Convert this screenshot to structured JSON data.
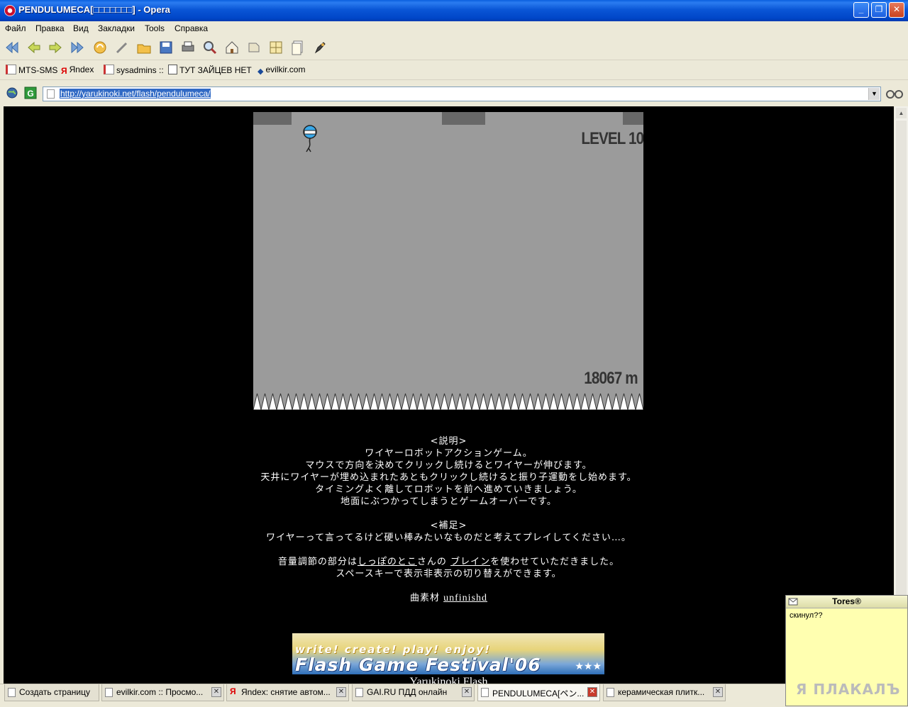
{
  "window": {
    "title": "PENDULUMECA[□□□□□□□] - Opera",
    "minimize": "_",
    "maximize": "❐",
    "close": "✕"
  },
  "menu": [
    "Файл",
    "Правка",
    "Вид",
    "Закладки",
    "Tools",
    "Справка"
  ],
  "bookmarks": [
    "MTS-SMS",
    "Яndex",
    "sysadmins ::",
    "ТУТ ЗАЙЦЕВ НЕТ",
    "evilkir.com"
  ],
  "address": {
    "url": "http://yarukinoki.net/flash/pendulumeca/"
  },
  "game": {
    "level": "LEVEL 10",
    "distance": "18067 m"
  },
  "description": {
    "heading": "<説明>",
    "lines": [
      "ワイヤーロボットアクションゲーム。",
      "マウスで方向を決めてクリックし続けるとワイヤーが伸びます。",
      "天井にワイヤーが埋め込まれたあともクリックし続けると振り子運動をし始めます。",
      "タイミングよく離してロボットを前へ進めていきましょう。",
      "地面にぶつかってしまうとゲームオーバーです。"
    ],
    "supplement_heading": "<補足>",
    "supplement": "ワイヤーって言ってるけど硬い棒みたいなものだと考えてプレイしてください…。",
    "volume_prefix": "音量調節の部分は",
    "volume_link1": "しっぽのとこ",
    "volume_mid": "さんの",
    "volume_link2": "ブレイン",
    "volume_suffix": "を使わせていただきました。",
    "spacekey": "スペースキーで表示非表示の切り替えができます。",
    "music_prefix": "曲素材",
    "music_link": "unfinishd"
  },
  "banner": {
    "sub": "write! create! play! enjoy!",
    "main": "Flash Game Festival'06",
    "stars": "★★★"
  },
  "footer_title": "Yarukinoki Flash",
  "tabs": [
    {
      "label": "Создать страницу"
    },
    {
      "label": "evilkir.com :: Просмо..."
    },
    {
      "label": "Яndex: снятие автом..."
    },
    {
      "label": "GAI.RU ПДД онлайн"
    },
    {
      "label": "PENDULUMECA[ペン..."
    },
    {
      "label": "керамическая плитк..."
    }
  ],
  "popup": {
    "name": "Tores®",
    "message": "скинул??",
    "logo": "Я ПЛАКАЛЪ"
  }
}
